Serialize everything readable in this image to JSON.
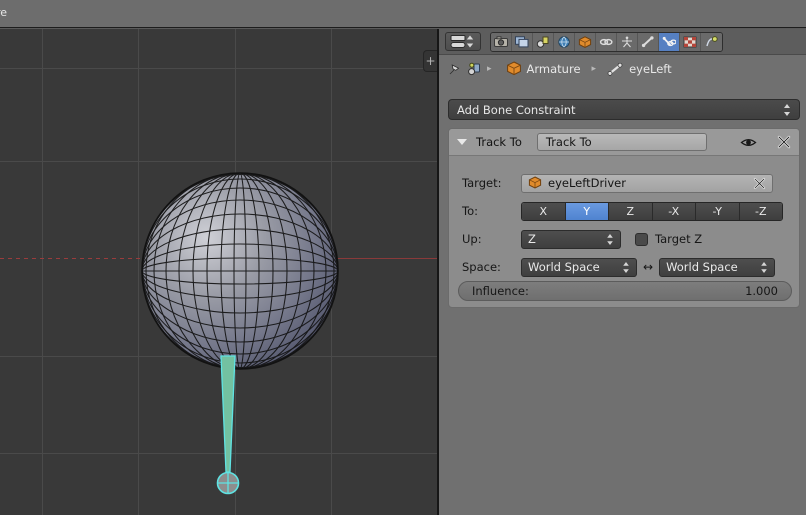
{
  "window": {
    "topbar_text": "re",
    "bg_color": "#5a5a5a"
  },
  "viewport": {
    "name": "3d-viewport",
    "background_color": "#393939",
    "grid_color": "#4a4a4a",
    "x_axis_color": "#9a3c3c",
    "objects": [
      {
        "name": "uv-sphere",
        "type": "mesh",
        "shaded": "solid-wireframe"
      },
      {
        "name": "bone",
        "type": "armature-bone",
        "color": "#77c3a4",
        "selected_outline": "#58e0e0"
      }
    ],
    "toolbar_toggle_label": "+"
  },
  "properties": {
    "editor_type_icon": "properties-editor-icon",
    "tabs": [
      {
        "name": "render",
        "icon": "camera-icon",
        "active": false
      },
      {
        "name": "scene-render-layers",
        "icon": "images-icon",
        "active": false
      },
      {
        "name": "scene",
        "icon": "scene-icon",
        "active": false
      },
      {
        "name": "world",
        "icon": "globe-icon",
        "active": false
      },
      {
        "name": "object",
        "icon": "cube-icon",
        "active": false
      },
      {
        "name": "constraints",
        "icon": "chain-icon",
        "active": false
      },
      {
        "name": "object-data",
        "icon": "armature-data-icon",
        "active": false
      },
      {
        "name": "bone",
        "icon": "bone-icon",
        "active": false
      },
      {
        "name": "bone-constraints",
        "icon": "bone-constraint-icon",
        "active": true
      },
      {
        "name": "texture",
        "icon": "checker-icon",
        "active": false
      },
      {
        "name": "physics",
        "icon": "physics-icon",
        "active": false
      }
    ],
    "breadcrumb": {
      "pin_icon": "pin-icon",
      "context_icon": "bone-constraint-icon",
      "items": [
        {
          "icon": "cube-icon",
          "label": "Armature"
        },
        {
          "icon": "bone-icon",
          "label": "eyeLeft"
        }
      ],
      "separator": "▸"
    },
    "add_constraint": {
      "label": "Add Bone Constraint",
      "arrows": "▲▼"
    },
    "constraint": {
      "expand_icon": "triangle-down-icon",
      "type_label": "Track To",
      "name_value": "Track To",
      "visibility_icon": "eye-icon",
      "delete_icon": "x-icon",
      "target": {
        "label": "Target:",
        "icon": "cube-icon",
        "value": "eyeLeftDriver",
        "clear_icon": "x-icon"
      },
      "to": {
        "label": "To:",
        "options": [
          "X",
          "Y",
          "Z",
          "-X",
          "-Y",
          "-Z"
        ],
        "selected": "Y",
        "selected_color": "#5680c2"
      },
      "up": {
        "label": "Up:",
        "value": "Z",
        "target_z_label": "Target Z",
        "target_z_checked": false
      },
      "space": {
        "label": "Space:",
        "owner_value": "World Space",
        "swap_icon": "↔",
        "target_value": "World Space"
      },
      "influence": {
        "label": "Influence:",
        "value": "1.000"
      }
    }
  }
}
